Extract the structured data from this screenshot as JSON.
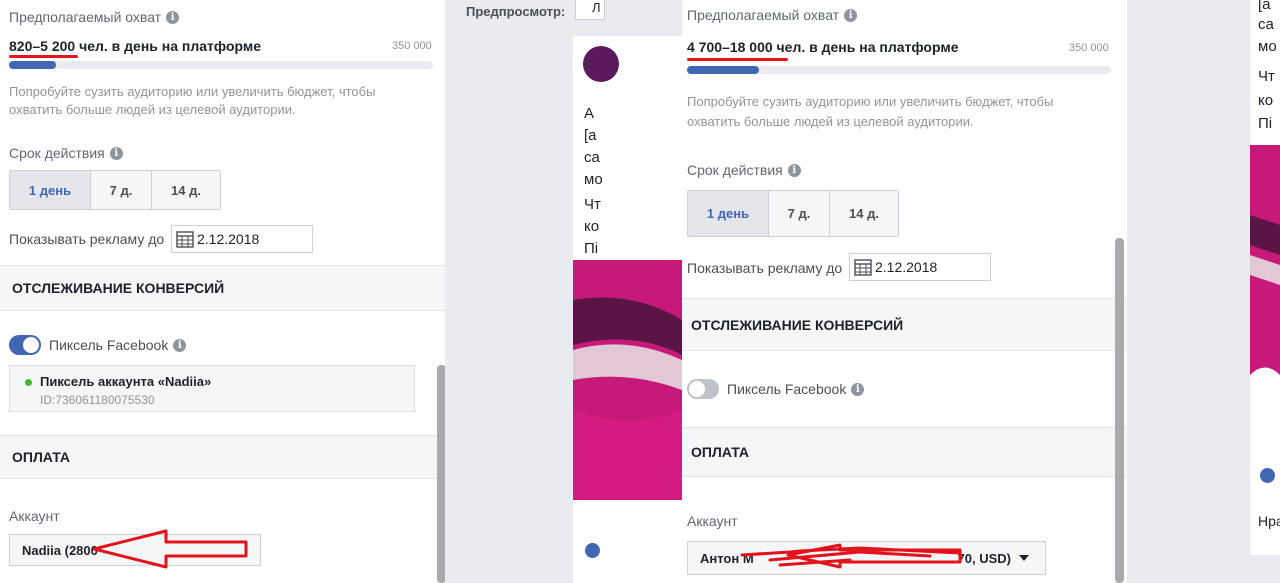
{
  "reach": {
    "label": "Предполагаемый охват",
    "left_value": "820–5 200 чел. в день на платформе",
    "right_value": "4 700–18 000 чел. в день на платформе",
    "max": "350 000",
    "left_fill_fraction": 0.11,
    "right_fill_fraction": 0.17,
    "hint_line1": "Попробуйте сузить аудиторию или увеличить бюджет, чтобы",
    "hint_line2": "охватить больше людей из целевой аудитории."
  },
  "duration": {
    "label": "Срок действия",
    "options": [
      "1 день",
      "7 д.",
      "14 д."
    ],
    "selected": "1 день"
  },
  "schedule": {
    "label": "Показывать рекламу до",
    "date": "2.12.2018"
  },
  "conversion": {
    "header": "ОТСЛЕЖИВАНИЕ КОНВЕРСИЙ",
    "pixel_label": "Пиксель Facebook",
    "pixel_name": "Пиксель аккаунта «Nadiia»",
    "pixel_id": "ID:736061180075530"
  },
  "payment": {
    "header": "ОПЛАТА",
    "account_label": "Аккаунт",
    "left_account": "Nadiia (2800",
    "right_account_start": "Антон М",
    "right_account_end": "70, USD)"
  },
  "preview": {
    "label": "Предпросмотр:",
    "partial_lines": [
      "А",
      "[а",
      "са",
      "мо",
      "Чт",
      "ко",
      "Пі"
    ],
    "right_partial_lines": [
      "[a",
      "ca",
      "мо",
      "Чт",
      "ко",
      "Пі"
    ],
    "right_partial_bottom": "Нра"
  },
  "colors": {
    "accent": "#4267b2",
    "annotation_red": "#e3131b",
    "magenta": "#b5176f"
  }
}
